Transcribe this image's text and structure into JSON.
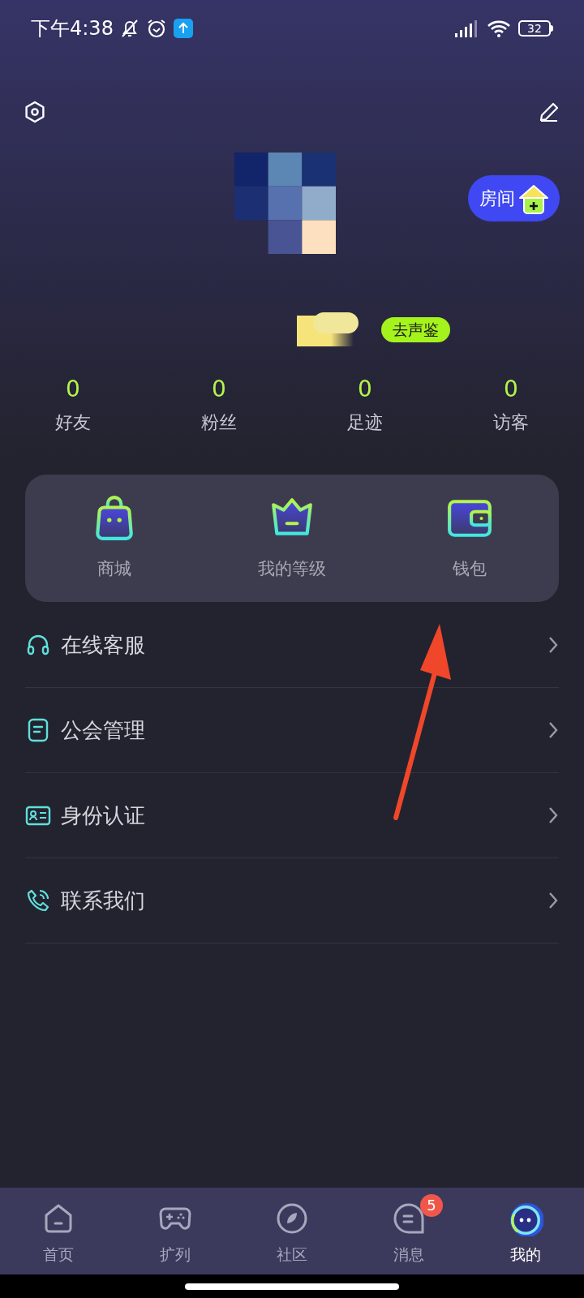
{
  "status_bar": {
    "time": "下午4:38",
    "battery": "32"
  },
  "profile": {
    "room_button": "房间",
    "voice_badge": "去声鉴"
  },
  "stats": [
    {
      "value": "0",
      "label": "好友"
    },
    {
      "value": "0",
      "label": "粉丝"
    },
    {
      "value": "0",
      "label": "足迹"
    },
    {
      "value": "0",
      "label": "访客"
    }
  ],
  "tools": [
    {
      "kind": "bag",
      "label": "商城"
    },
    {
      "kind": "crown",
      "label": "我的等级"
    },
    {
      "kind": "wallet",
      "label": "钱包"
    }
  ],
  "menu": [
    {
      "kind": "headset",
      "label": "在线客服"
    },
    {
      "kind": "note",
      "label": "公会管理"
    },
    {
      "kind": "card",
      "label": "身份认证"
    },
    {
      "kind": "phone",
      "label": "联系我们"
    }
  ],
  "annotation": {
    "kind": "arrow"
  },
  "tab_bar": [
    {
      "kind": "home",
      "label": "首页",
      "selected": false
    },
    {
      "kind": "gamepad",
      "label": "扩列",
      "selected": false
    },
    {
      "kind": "compass",
      "label": "社区",
      "selected": false
    },
    {
      "kind": "chat",
      "label": "消息",
      "selected": false,
      "badge": "5"
    },
    {
      "kind": "avatar",
      "label": "我的",
      "selected": true
    }
  ]
}
